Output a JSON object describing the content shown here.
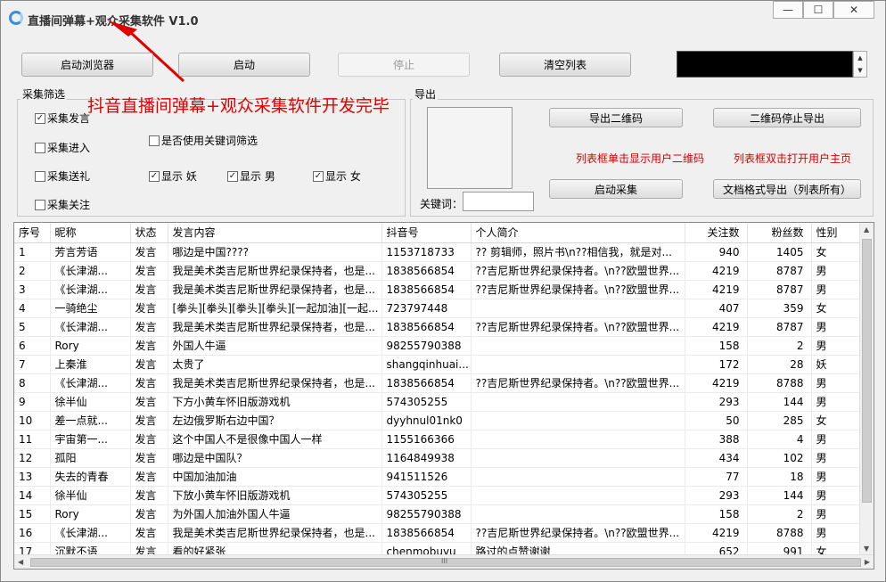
{
  "window": {
    "title": "直播间弹幕+观众采集软件 V1.0",
    "min": "—",
    "max": "☐",
    "close": "✕"
  },
  "toolbar": {
    "launch_browser": "启动浏览器",
    "start": "启动",
    "stop": "停止",
    "clear_list": "清空列表",
    "spin_up": "▲",
    "spin_down": "▼"
  },
  "filter": {
    "group": "采集筛选",
    "collect_speech": "采集发言",
    "collect_enter": "采集进入",
    "collect_gift": "采集送礼",
    "collect_follow": "采集关注",
    "use_keyword": "是否使用关键词筛选",
    "show_demon": "显示 妖",
    "show_male": "显示 男",
    "show_female": "显示 女",
    "check": "✓"
  },
  "export": {
    "group": "导出",
    "export_qr": "导出二维码",
    "stop_qr": "二维码停止导出",
    "hint_single": "列表框单击显示用户二维码",
    "hint_double": "列表框双击打开用户主页",
    "start_collect": "启动采集",
    "export_doc": "文档格式导出（列表所有）",
    "keyword_label": "关键词："
  },
  "overlay": "抖音直播间弹幕+观众采集软件开发完毕",
  "colors": {
    "accent_red": "#e00000"
  },
  "table": {
    "columns": [
      "序号",
      "昵称",
      "状态",
      "发言内容",
      "抖音号",
      "个人简介",
      "关注数",
      "粉丝数",
      "性别"
    ],
    "rows": [
      [
        "1",
        "芳言芳语",
        "发言",
        "哪边是中国????",
        "1153718733",
        "?? 剪辑师，照片书\\n??相信我，就是对...",
        "940",
        "1405",
        "女"
      ],
      [
        "2",
        "《长津湖...",
        "发言",
        "我是美术类吉尼斯世界纪录保持者，也是...",
        "1838566854",
        "??吉尼斯世界纪录保持者。\\n??欧盟世界...",
        "4219",
        "8787",
        "男"
      ],
      [
        "3",
        "《长津湖...",
        "发言",
        "我是美术类吉尼斯世界纪录保持者，也是...",
        "1838566854",
        "??吉尼斯世界纪录保持者。\\n??欧盟世界...",
        "4219",
        "8787",
        "男"
      ],
      [
        "4",
        "一骑绝尘",
        "发言",
        "[拳头][拳头][拳头][拳头][一起加油][一起...",
        "723797448",
        "",
        "407",
        "359",
        "女"
      ],
      [
        "5",
        "《长津湖...",
        "发言",
        "我是美术类吉尼斯世界纪录保持者，也是...",
        "1838566854",
        "??吉尼斯世界纪录保持者。\\n??欧盟世界...",
        "4219",
        "8787",
        "男"
      ],
      [
        "6",
        "Rory",
        "发言",
        "外国人牛逼",
        "98255790388",
        "",
        "158",
        "2",
        "男"
      ],
      [
        "7",
        "上秦淮",
        "发言",
        "太贵了",
        "shangqinhuai...",
        "",
        "172",
        "28",
        "妖"
      ],
      [
        "8",
        "《长津湖...",
        "发言",
        "我是美术类吉尼斯世界纪录保持者，也是...",
        "1838566854",
        "??吉尼斯世界纪录保持者。\\n??欧盟世界...",
        "4219",
        "8788",
        "男"
      ],
      [
        "9",
        "徐半仙",
        "发言",
        "下方小黄车怀旧版游戏机",
        "574305255",
        "",
        "293",
        "144",
        "男"
      ],
      [
        "10",
        "差一点就...",
        "发言",
        "左边俄罗斯右边中国？",
        "dyyhnul01nk0",
        "",
        "50",
        "285",
        "女"
      ],
      [
        "11",
        "宇宙第一...",
        "发言",
        "这个中国人不是很像中国人一样",
        "1155166366",
        "",
        "388",
        "4",
        "男"
      ],
      [
        "12",
        "孤阳",
        "发言",
        "哪边是中国队？",
        "1164849938",
        "",
        "434",
        "102",
        "男"
      ],
      [
        "13",
        "失去的青春",
        "发言",
        "中国加油加油",
        "941511526",
        "",
        "77",
        "18",
        "男"
      ],
      [
        "14",
        "徐半仙",
        "发言",
        "下放小黄车怀旧版游戏机",
        "574305255",
        "",
        "293",
        "144",
        "男"
      ],
      [
        "15",
        "Rory",
        "发言",
        "为外国人加油外国人牛逼",
        "98255790388",
        "",
        "158",
        "2",
        "男"
      ],
      [
        "16",
        "《长津湖...",
        "发言",
        "我是美术类吉尼斯世界纪录保持者，也是...",
        "1838566854",
        "??吉尼斯世界纪录保持者。\\n??欧盟世界...",
        "4219",
        "8788",
        "男"
      ],
      [
        "17",
        "沉默不语",
        "发言",
        "看的好紧张",
        "chenmobuyu",
        "路过的点赞谢谢",
        "652",
        "991",
        "女"
      ]
    ]
  },
  "scroll": {
    "up": "▲",
    "down": "▼",
    "left": "◀",
    "right": "▶",
    "grip": "III"
  }
}
